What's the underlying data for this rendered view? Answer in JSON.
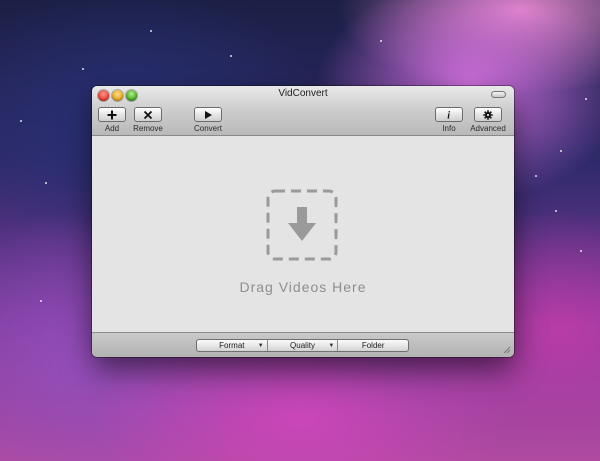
{
  "window": {
    "title": "VidConvert"
  },
  "toolbar": {
    "add_label": "Add",
    "remove_label": "Remove",
    "convert_label": "Convert",
    "info_label": "Info",
    "advanced_label": "Advanced"
  },
  "dropzone": {
    "label": "Drag Videos Here",
    "icon": "download-arrow-icon"
  },
  "bottombar": {
    "format_label": "Format",
    "quality_label": "Quality",
    "folder_label": "Folder"
  },
  "colors": {
    "close": "#e0362a",
    "minimize": "#e09b14",
    "zoom": "#3ea31a",
    "dropzone": "#9a9a9a"
  }
}
